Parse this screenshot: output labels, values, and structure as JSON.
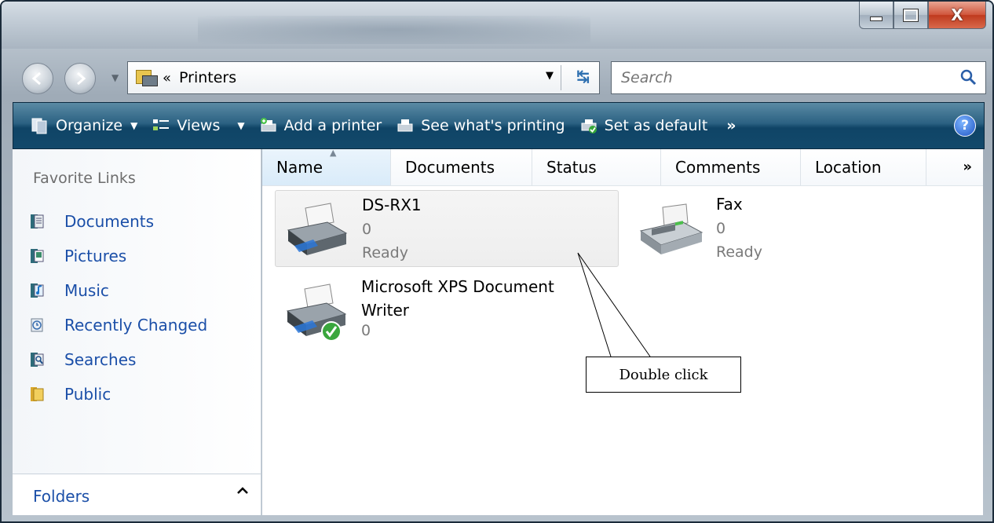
{
  "window": {
    "caption_buttons": [
      "minimize",
      "maximize",
      "close"
    ],
    "close_glyph": "X"
  },
  "address_bar": {
    "separator": "«",
    "location": "Printers"
  },
  "search": {
    "placeholder": "Search"
  },
  "toolbar": {
    "organize": "Organize",
    "views": "Views",
    "add_printer": "Add a printer",
    "see_printing": "See what's printing",
    "set_default": "Set as default",
    "more": "»",
    "help": "?"
  },
  "nav_pane": {
    "title": "Favorite Links",
    "links": [
      {
        "label": "Documents",
        "icon": "documents-icon"
      },
      {
        "label": "Pictures",
        "icon": "pictures-icon"
      },
      {
        "label": "Music",
        "icon": "music-icon"
      },
      {
        "label": "Recently Changed",
        "icon": "recent-icon"
      },
      {
        "label": "Searches",
        "icon": "searches-icon"
      },
      {
        "label": "Public",
        "icon": "public-folder-icon"
      }
    ],
    "folders_label": "Folders",
    "folders_chevron": "^"
  },
  "columns": [
    "Name",
    "Documents",
    "Status",
    "Comments",
    "Location"
  ],
  "more_columns": "»",
  "printers": [
    {
      "name": "DS-RX1",
      "docs": "0",
      "status": "Ready",
      "icon": "printer-icon"
    },
    {
      "name": "Fax",
      "docs": "0",
      "status": "Ready",
      "icon": "fax-icon"
    },
    {
      "name": "Microsoft XPS Document Writer",
      "name_line1": "Microsoft XPS Document",
      "name_line2": "Writer",
      "docs": "0",
      "icon": "default-printer-icon"
    }
  ],
  "callout": {
    "text": "Double click"
  },
  "colors": {
    "toolbar_dark": "#13496b",
    "link_blue": "#1b4fa8",
    "muted_gray": "#7a7a7a",
    "close_red": "#c9462a"
  }
}
